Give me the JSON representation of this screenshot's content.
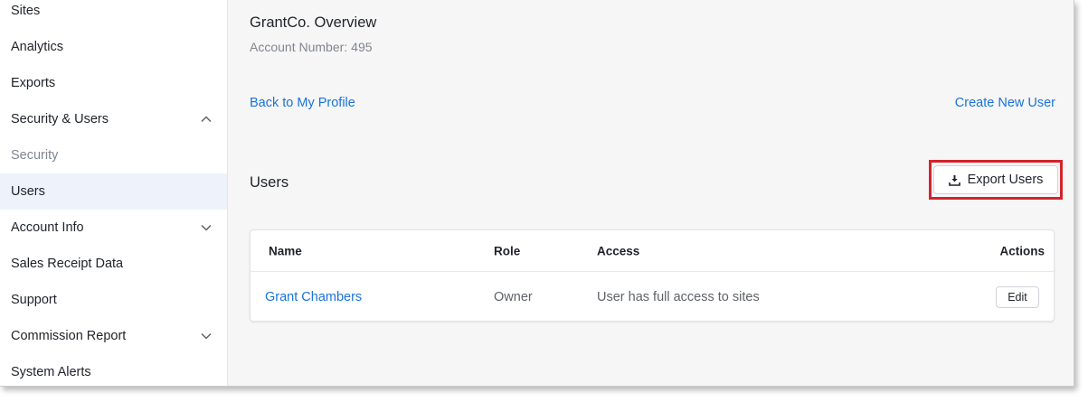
{
  "sidebar": {
    "items": [
      {
        "label": "Sites"
      },
      {
        "label": "Analytics"
      },
      {
        "label": "Exports"
      },
      {
        "label": "Security & Users",
        "chevron": "chevron-up-icon"
      },
      {
        "label": "Security"
      },
      {
        "label": "Users"
      },
      {
        "label": "Account Info",
        "chevron": "chevron-down-icon"
      },
      {
        "label": "Sales Receipt Data"
      },
      {
        "label": "Support"
      },
      {
        "label": "Commission Report",
        "chevron": "chevron-down-icon"
      },
      {
        "label": "System Alerts"
      }
    ]
  },
  "header": {
    "title": "GrantCo. Overview",
    "account_label": "Account Number:",
    "account_number": "495"
  },
  "links": {
    "back": "Back to My Profile",
    "create": "Create New User"
  },
  "users_section": {
    "title": "Users",
    "export_label": "Export Users",
    "export_icon": "download-icon",
    "columns": {
      "name": "Name",
      "role": "Role",
      "access": "Access",
      "actions": "Actions"
    },
    "rows": [
      {
        "name": "Grant Chambers",
        "role": "Owner",
        "access": "User has full access to sites",
        "action": "Edit"
      }
    ]
  },
  "colors": {
    "link": "#1a73d9",
    "highlight": "#d3232c",
    "active_nav": "#eef3fb"
  }
}
